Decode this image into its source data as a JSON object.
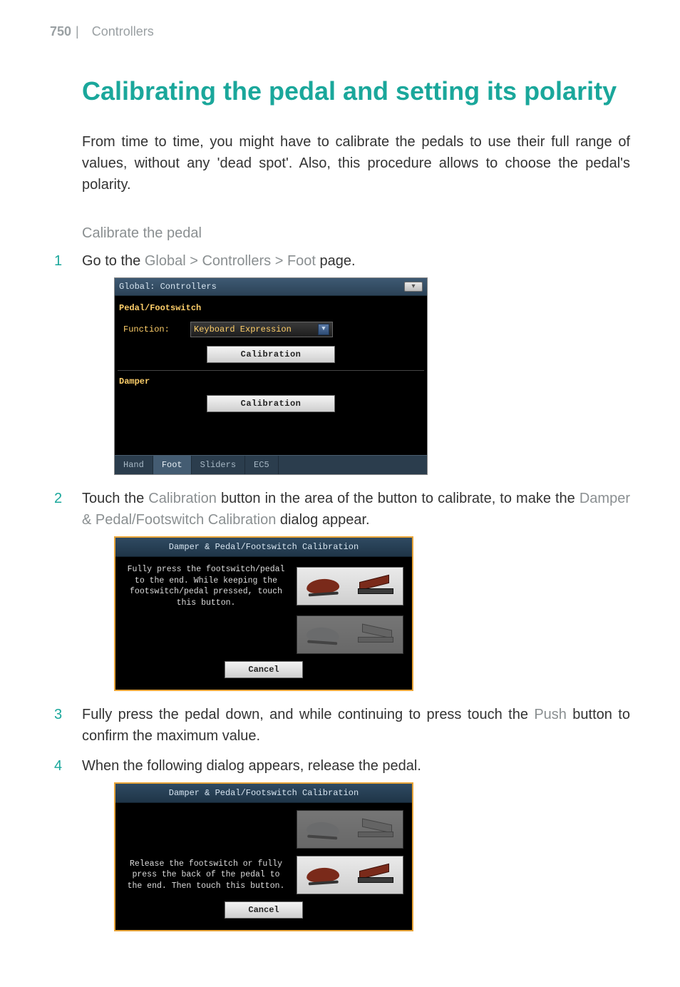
{
  "header": {
    "page_number": "750",
    "bar": "|",
    "section": "Controllers"
  },
  "title": "Calibrating the pedal and setting its polarity",
  "intro": "From time to time, you might have to calibrate the pedals to use their full range of values, without any 'dead spot'. Also, this procedure allows to choose the pedal's polarity.",
  "subhead": "Calibrate the pedal",
  "steps": {
    "s1": {
      "prefix": "Go to the ",
      "path": "Global > Controllers > Foot",
      "suffix": " page."
    },
    "s2": {
      "prefix": "Touch the ",
      "btn": "Calibration",
      "mid": " button in the area of the button to calibrate, to make the ",
      "dlg": "Damper & Pedal/Footswitch Calibration",
      "suffix": " dialog appear."
    },
    "s3": {
      "prefix": "Fully press the pedal down, and while continuing to press touch the ",
      "btn": "Push",
      "suffix": " button to confirm the maximum value."
    },
    "s4": {
      "text": "When the following dialog appears, release the pedal."
    }
  },
  "shot1": {
    "title": "Global: Controllers",
    "section_pf": "Pedal/Footswitch",
    "function_label": "Function:",
    "function_value": "Keyboard Expression",
    "calibration_btn": "Calibration",
    "section_damper": "Damper",
    "tabs": [
      "Hand",
      "Foot",
      "Sliders",
      "EC5"
    ],
    "active_tab_index": 1
  },
  "shot2": {
    "title": "Damper & Pedal/Footswitch Calibration",
    "msg_press": "Fully press the footswitch/pedal to the end. While keeping the footswitch/pedal pressed, touch this button.",
    "cancel": "Cancel"
  },
  "shot3": {
    "title": "Damper & Pedal/Footswitch Calibration",
    "msg_release": "Release the footswitch or fully press the back of the pedal to the end. Then touch this button.",
    "cancel": "Cancel"
  }
}
